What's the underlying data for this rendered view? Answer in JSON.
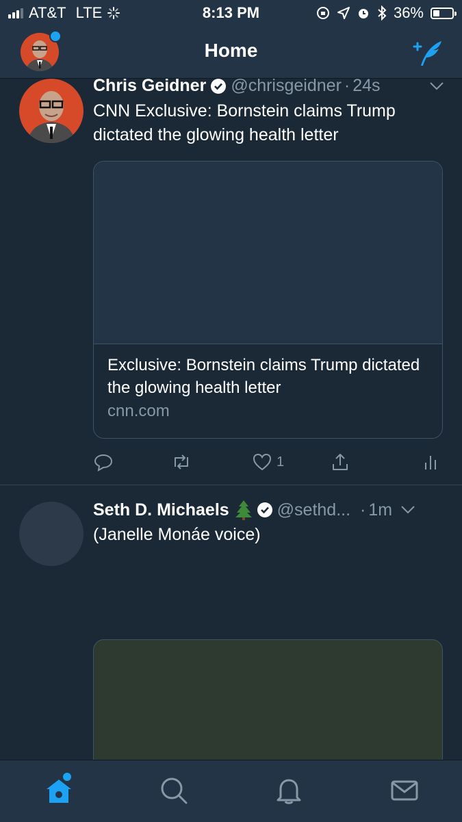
{
  "status_bar": {
    "carrier": "AT&T",
    "network": "LTE",
    "time": "8:13 PM",
    "battery_percent": "36%",
    "battery_level": 0.36
  },
  "nav": {
    "title": "Home"
  },
  "tweets": [
    {
      "name": "Chris Geidner",
      "handle": "@chrisgeidner",
      "separator": "·",
      "time": "24s",
      "text": "CNN Exclusive: Bornstein claims Trump dictated the glowing health letter",
      "card": {
        "title": "Exclusive: Bornstein claims Trump dictated the glowing health letter",
        "domain": "cnn.com"
      },
      "like_count": "1"
    },
    {
      "name": "Seth D. Michaels",
      "handle": "@sethd...",
      "separator": "·",
      "time": "1m",
      "text": "(Janelle Monáe voice)"
    }
  ],
  "icons": {
    "nav_avatar": "profile-avatar",
    "compose": "compose-tweet-icon",
    "verified": "verified-badge-icon",
    "reply": "reply-icon",
    "retweet": "retweet-icon",
    "like": "heart-icon",
    "share": "share-icon",
    "analytics": "analytics-icon",
    "tab_home": "home-icon",
    "tab_search": "search-icon",
    "tab_notifications": "bell-icon",
    "tab_messages": "mail-icon"
  },
  "colors": {
    "background": "#1b2836",
    "bar_background": "#243447",
    "accent": "#1da1f2",
    "secondary_text": "#8899a6"
  }
}
